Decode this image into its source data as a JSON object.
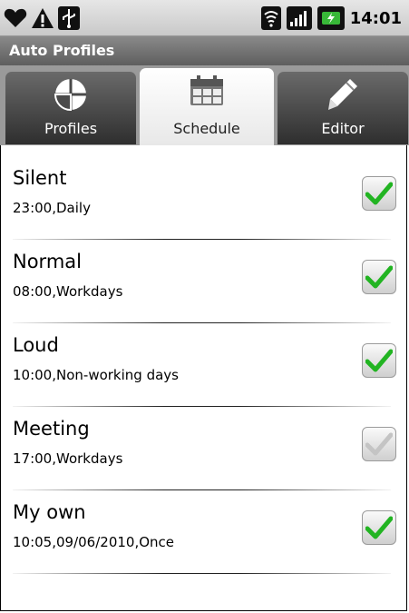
{
  "status_bar": {
    "time": "14:01",
    "left_icons": [
      "heart-icon",
      "warning-icon",
      "usb-icon"
    ],
    "right_icons": [
      "wifi-icon",
      "signal-icon",
      "battery-charging-icon"
    ]
  },
  "app": {
    "title": "Auto Profiles"
  },
  "tabs": [
    {
      "label": "Profiles",
      "icon": "profiles-pie-icon",
      "active": false
    },
    {
      "label": "Schedule",
      "icon": "calendar-icon",
      "active": true
    },
    {
      "label": "Editor",
      "icon": "pencil-icon",
      "active": false
    }
  ],
  "schedule": [
    {
      "name": "Silent",
      "details": "23:00,Daily",
      "enabled": true,
      "greyed": false
    },
    {
      "name": "Normal",
      "details": "08:00,Workdays",
      "enabled": true,
      "greyed": false
    },
    {
      "name": "Loud",
      "details": "10:00,Non-working days",
      "enabled": true,
      "greyed": false
    },
    {
      "name": "Meeting",
      "details": "17:00,Workdays",
      "enabled": true,
      "greyed": true
    },
    {
      "name": "My own",
      "details": "10:05,09/06/2010,Once",
      "enabled": true,
      "greyed": false
    }
  ],
  "colors": {
    "check_green": "#22b422",
    "check_grey": "#bdbdbd",
    "titlebar": "#6e6e6e"
  }
}
